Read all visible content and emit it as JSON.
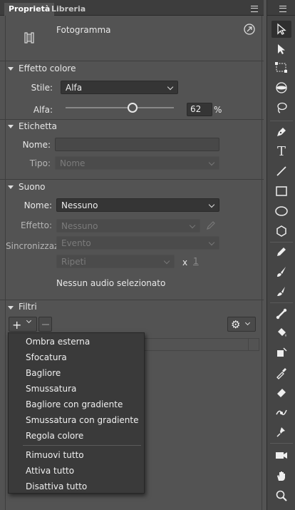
{
  "tabs": [
    {
      "label": "Proprietà",
      "active": true
    },
    {
      "label": "Libreria",
      "active": false
    }
  ],
  "object": {
    "type_label": "Fotogramma"
  },
  "color_effect": {
    "header": "Effetto colore",
    "style_label": "Stile:",
    "style_value": "Alfa",
    "alpha_label": "Alfa:",
    "alpha_value": "62",
    "alpha_unit": "%",
    "alpha_fraction": 0.62
  },
  "label_section": {
    "header": "Etichetta",
    "name_label": "Nome:",
    "name_value": "",
    "type_label": "Tipo:",
    "type_value": "Nome"
  },
  "sound": {
    "header": "Suono",
    "name_label": "Nome:",
    "name_value": "Nessuno",
    "effect_label": "Effetto:",
    "effect_value": "Nessuno",
    "sync_label": "Sincronizzazione:",
    "sync_value": "Evento",
    "repeat_value": "Ripeti",
    "repeat_x": "x",
    "repeat_count": "1",
    "status": "Nessun audio selezionato"
  },
  "filters": {
    "header": "Filtri",
    "menu": [
      "Ombra esterna",
      "Sfocatura",
      "Bagliore",
      "Smussatura",
      "Bagliore con gradiente",
      "Smussatura con gradiente",
      "Regola colore"
    ],
    "menu_actions": [
      "Rimuovi tutto",
      "Attiva tutto",
      "Disattiva tutto"
    ]
  },
  "tools": [
    "selection-arrow-icon",
    "subselection-arrow-icon",
    "free-transform-icon",
    "3d-rotation-icon",
    "lasso-icon",
    "pen-icon",
    "text-icon",
    "line-icon",
    "rectangle-icon",
    "oval-icon",
    "polystar-icon",
    "pencil-icon",
    "brush-icon",
    "paint-brush-icon",
    "bone-icon",
    "paint-bucket-icon",
    "ink-bottle-icon",
    "eyedropper-icon",
    "eraser-icon",
    "width-tool-icon",
    "pin-icon",
    "camera-icon",
    "hand-icon",
    "zoom-icon"
  ],
  "colors": {
    "panel": "#535353",
    "toolbar": "#454545",
    "field": "#353535",
    "popup": "#3a3a3a"
  }
}
